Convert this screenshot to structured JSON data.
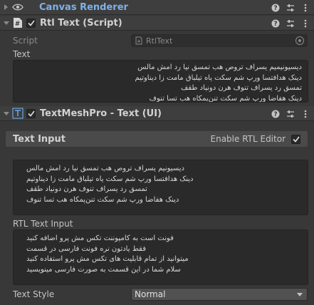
{
  "canvas_renderer": {
    "title": "Canvas Renderer",
    "icons": [
      "eye-icon",
      "help-icon",
      "preset-icon",
      "menu-icon"
    ]
  },
  "rtl_text_script": {
    "title": "Rtl Text (Script)",
    "enabled": true,
    "script_label": "Script",
    "script_value": "RtlText",
    "text_label": "Text",
    "text_value": "دیسیونیمیم یسراف تروص هب تمسق نیا رد امش مالس\nدینک هدافتسا ورپ شم سکت یاه تیلباق مامت زا دیناوتیم\nتمسق رد یسراف تنوف هرن دونیاد طقف\nدینک هفاضا ورپ شم سکت تنن‌پمکاه هب تسا تنوف"
  },
  "textmeshpro": {
    "title": "TextMeshPro - Text (UI)",
    "enabled": true,
    "text_input_label": "Text Input",
    "enable_rtl_label": "Enable RTL Editor",
    "enable_rtl_checked": true,
    "text_input_value": "دیسیونیم یسراف تروص هب تمسق نیا رد امش مالس\nدینک هدافتسا ورپ شم سکت یاه تیلباق مامت زا دیناوتیم\nتمسق رد یسراف تنوف هرن دونیاد طقف\nدینک هفاضا ورپ شم سکت تنن‌پمکاه هب تسا تنوف",
    "rtl_text_input_label": "RTL Text Input",
    "rtl_text_input_value": "فونت است به کامپوننت تکس مش پرو اضافه کنید\nفقط یادتون نره فونت فارسی در قسمت\nمیتوانید از تمام قابلیت های تکس مش پرو استفاده کنید\nسلام شما در این قسمت به صورت فارسی مینویسید",
    "text_style_label": "Text Style",
    "text_style_value": "Normal"
  }
}
